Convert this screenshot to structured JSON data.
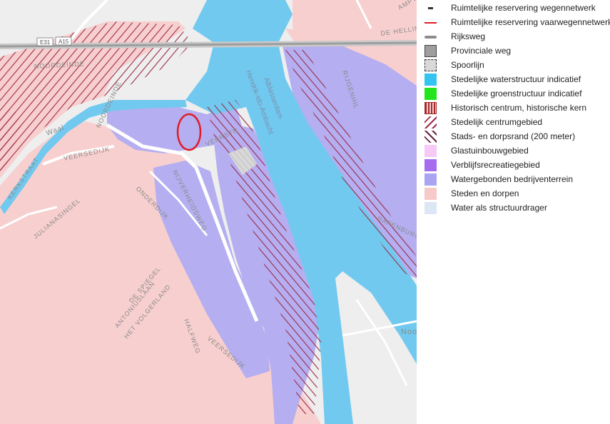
{
  "colors": {
    "background": "#f1f0ef",
    "steden_en_dorpen": "#f8cfcf",
    "watergebonden": "#b5aef0",
    "water": "#72c9ef",
    "hatch": "#9a2d4a",
    "historic": "#a52a2a",
    "marker": "#e01c24"
  },
  "map_labels": {
    "noordeinde_top": "NOORDEINDE",
    "noordeinde_mid": "NOORDEINDE",
    "veersedijk": "VEERSEDIJK",
    "veerstraat": "VEERSTR",
    "kerkstraat": "KERKSTRAAT",
    "julianasingel": "JULIANASINGEL",
    "ondersdijk": "ONDERDIJK",
    "nijverheidsweg": "NIJVERHEIDSWEG",
    "de_spiegel": "DE SPIEGEL",
    "antoniuslaan": "ANTONIUSLAAN",
    "het_volgerland": "HET VOLGERLAND",
    "halfweg": "HALFWEG",
    "veersedijk_south": "VEERSEDIJK",
    "rijgenhil": "RIJGENHIL",
    "rapenburg": "RAPENBURG",
    "de_helling": "DE HELLIN",
    "ampt": "AMPT",
    "noord": "Noo",
    "waal": "Waal",
    "alblasserdam": "Alblasserdam",
    "hendrik_ido_ambacht": "Hendrik-Ido-Ambacht",
    "e31": "E31",
    "a15": "A15"
  },
  "legend": {
    "items": [
      {
        "label": "Ruimtelijke reservering wegennetwerk",
        "icon": "dash-icon",
        "key": "wegennetwerk"
      },
      {
        "label": "Ruimtelijke reservering vaarwegennetwerk",
        "icon": "red-line-icon",
        "key": "vaarwegennetwerk"
      },
      {
        "label": "Rijksweg",
        "icon": "grey-line-icon",
        "key": "rijksweg"
      },
      {
        "label": "Provinciale weg",
        "icon": "grey-square-icon",
        "key": "provinciale_weg"
      },
      {
        "label": "Spoorlijn",
        "icon": "dashed-square-icon",
        "key": "spoorlijn"
      },
      {
        "label": "Stedelijke waterstructuur indicatief",
        "icon": "blue-square-icon",
        "key": "waterstructuur"
      },
      {
        "label": "Stedelijke groenstructuur indicatief",
        "icon": "green-square-icon",
        "key": "groenstructuur"
      },
      {
        "label": "Historisch centrum, historische kern",
        "icon": "vertical-stripes-icon",
        "key": "historisch"
      },
      {
        "label": "Stedelijk centrumgebied",
        "icon": "diagonal-stripes-icon",
        "key": "centrumgebied"
      },
      {
        "label": "Stads- en dorpsrand (200 meter)",
        "icon": "back-diagonal-stripes-icon",
        "key": "dorpsrand"
      },
      {
        "label": "Glastuinbouwgebied",
        "icon": "pink-square-icon",
        "key": "glastuinbouw"
      },
      {
        "label": "Verblijfsrecreatiegebied",
        "icon": "purple-square-icon",
        "key": "verblijfsrecreatie"
      },
      {
        "label": "Watergebonden bedrijventerrein",
        "icon": "lavender-square-icon",
        "key": "watergebonden"
      },
      {
        "label": "Steden en dorpen",
        "icon": "salmon-square-icon",
        "key": "steden"
      },
      {
        "label": "Water als structuurdrager",
        "icon": "light-blue-square-icon",
        "key": "water_structuurdrager"
      }
    ]
  }
}
